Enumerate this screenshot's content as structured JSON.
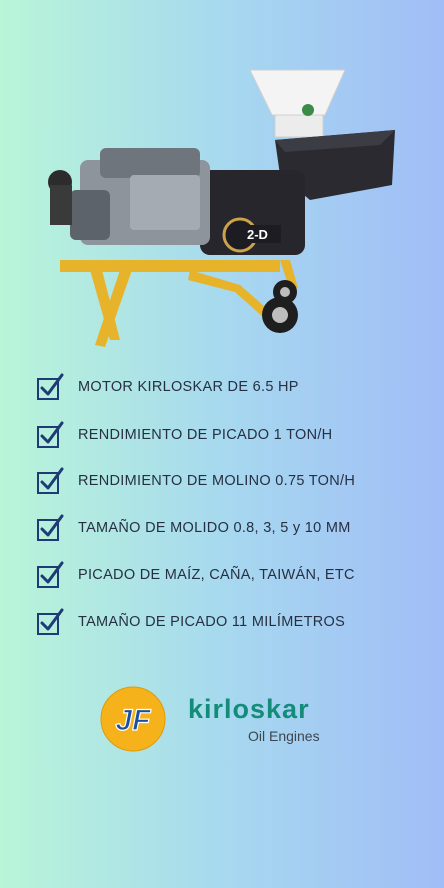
{
  "features": [
    {
      "label": "MOTOR KIRLOSKAR DE 6.5 HP",
      "icon": "checkbox-icon"
    },
    {
      "label": "RENDIMIENTO DE PICADO 1 TON/H",
      "icon": "checkbox-icon"
    },
    {
      "label": "RENDIMIENTO DE MOLINO 0.75 TON/H",
      "icon": "checkbox-icon"
    },
    {
      "label": "TAMAÑO DE MOLIDO 0.8, 3, 5 y 10 MM",
      "icon": "checkbox-icon"
    },
    {
      "label": "PICADO DE MAÍZ, CAÑA, TAIWÁN, ETC",
      "icon": "checkbox-icon"
    },
    {
      "label": "TAMAÑO DE PICADO 11 MILÍMETROS",
      "icon": "checkbox-icon"
    }
  ],
  "machine_badge": "2-D",
  "logos": {
    "jf_text": "JF",
    "kirloskar_word": "kirloskar",
    "kirloskar_sub": "Oil Engines"
  },
  "colors": {
    "check": "#1f3b73",
    "brand_green": "#148c7a",
    "jf_yellow": "#f6b21a",
    "jf_blue": "#1d4fa0",
    "frame_yellow": "#e7b32b"
  }
}
